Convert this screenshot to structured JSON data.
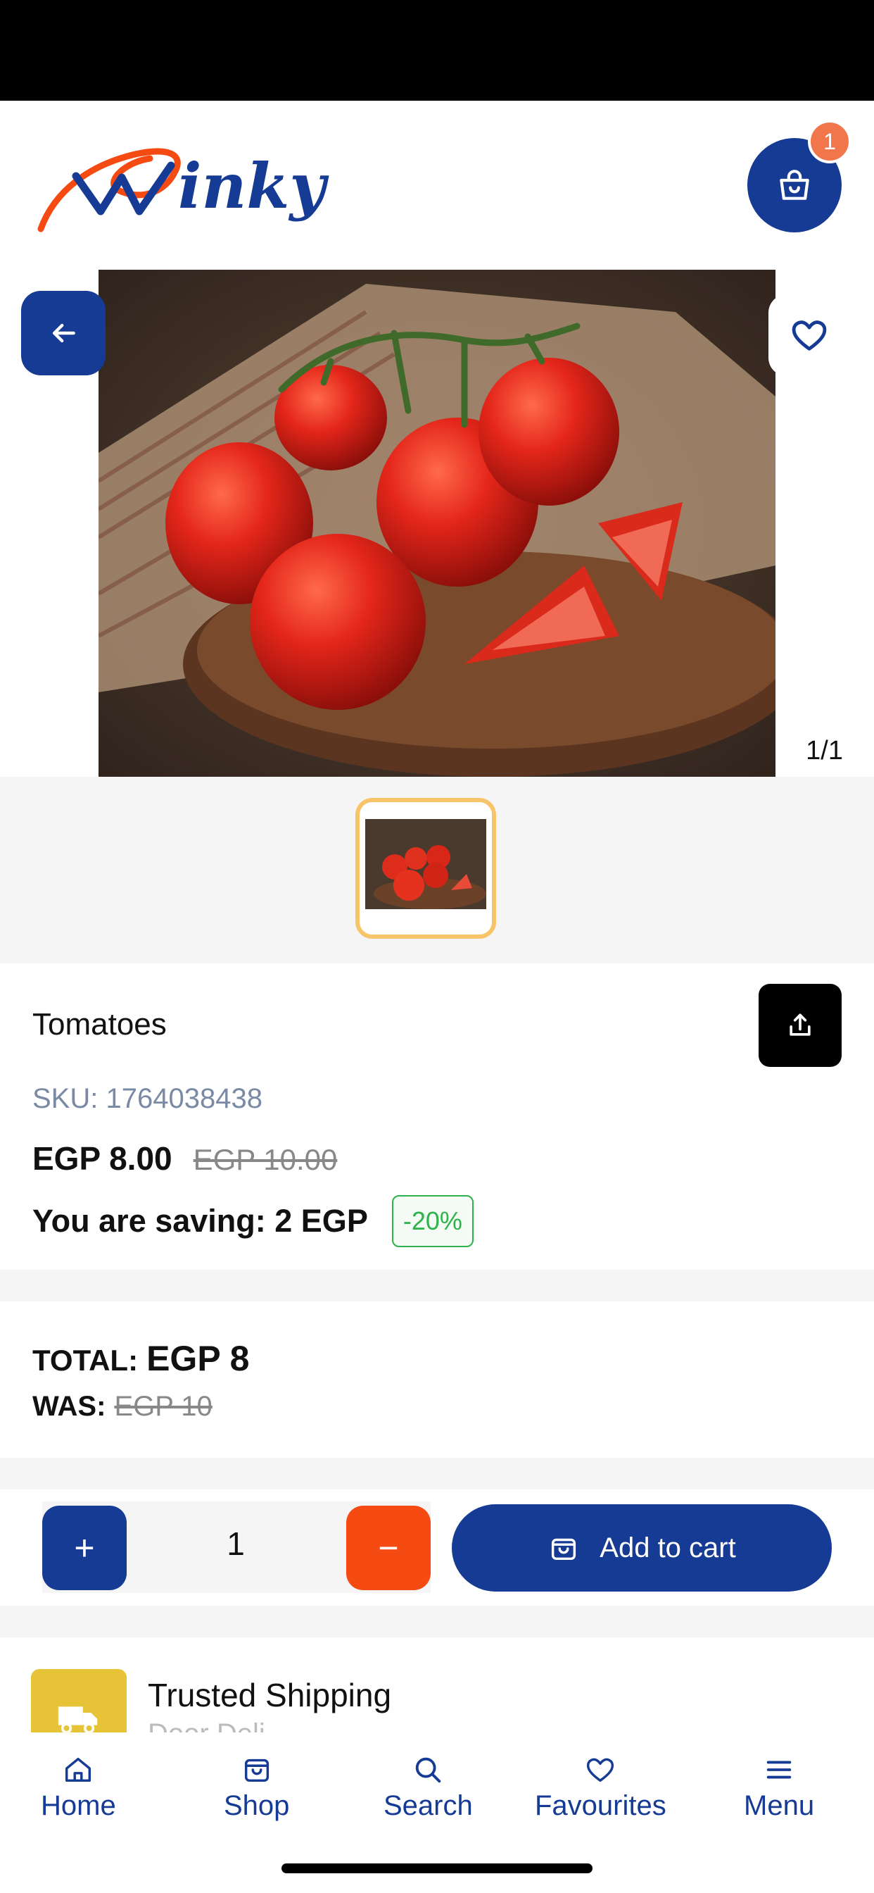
{
  "header": {
    "logo_text": "Winky",
    "cart_count": "1",
    "cart_icon": "shopping-bag-icon"
  },
  "product": {
    "image_counter": "1/1",
    "name": "Tomatoes",
    "sku_label": "SKU:",
    "sku_value": "1764038438",
    "price_now": "EGP 8.00",
    "price_old": "EGP 10.00",
    "saving_text": "You are saving: 2 EGP",
    "discount": "-20%"
  },
  "totals": {
    "total_label": "TOTAL:",
    "total_value": "EGP 8",
    "was_label": "WAS:",
    "was_value": "EGP 10"
  },
  "quantity": {
    "plus": "+",
    "value": "1",
    "minus": "−",
    "add_to_cart": "Add to cart"
  },
  "shipping": {
    "title": "Trusted Shipping",
    "subtitle": "Door Deli..."
  },
  "nav": {
    "items": [
      {
        "label": "Home",
        "icon": "home-icon"
      },
      {
        "label": "Shop",
        "icon": "shopping-bag-icon"
      },
      {
        "label": "Search",
        "icon": "search-icon"
      },
      {
        "label": "Favourites",
        "icon": "heart-icon"
      },
      {
        "label": "Menu",
        "icon": "menu-icon"
      }
    ]
  },
  "colors": {
    "primary": "#163b94",
    "accent_orange": "#f54a12",
    "badge_orange": "#f2764c",
    "thumb_border": "#f7c46a",
    "discount_green": "#2eb34b",
    "shipping_yellow": "#e7c437"
  }
}
